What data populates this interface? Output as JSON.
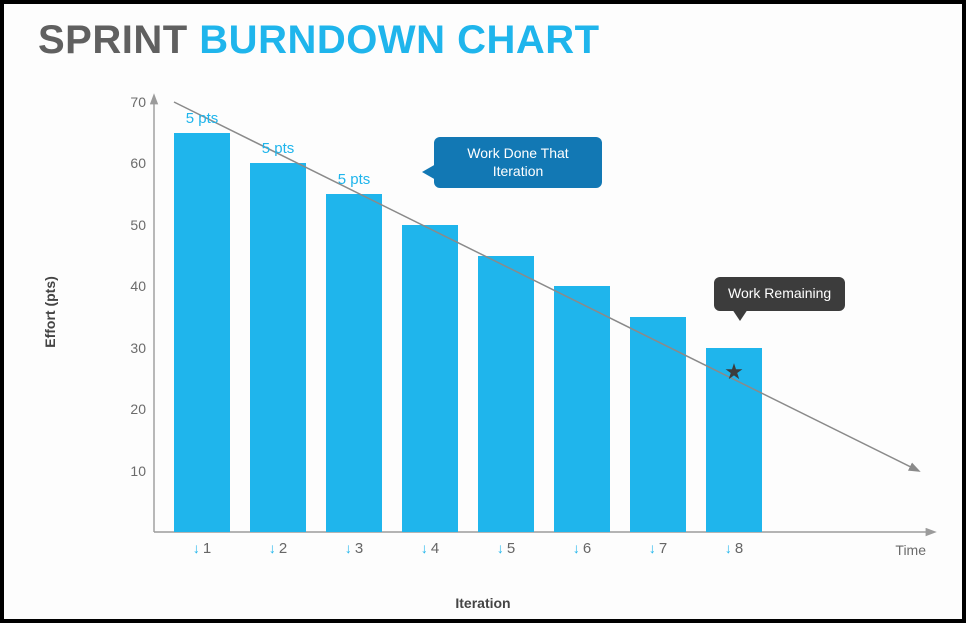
{
  "title": {
    "a": "SPRINT ",
    "b": "BURNDOWN CHART"
  },
  "ylabel": "Effort (pts)",
  "xlabel": "Iteration",
  "x_time": "Time",
  "callouts": {
    "work_done": "Work Done That Iteration",
    "work_remaining": "Work Remaining"
  },
  "chart_data": {
    "type": "bar",
    "categories": [
      "1",
      "2",
      "3",
      "4",
      "5",
      "6",
      "7",
      "8"
    ],
    "values": [
      65,
      60,
      55,
      50,
      45,
      40,
      35,
      30
    ],
    "bar_labels": [
      "5 pts",
      "5 pts",
      "5 pts",
      "",
      "",
      "",
      "",
      ""
    ],
    "ylim": [
      0,
      70
    ],
    "yticks": [
      10,
      20,
      30,
      40,
      50,
      60,
      70
    ],
    "trend": {
      "x1": 0,
      "y1": 70,
      "x2": 1,
      "y2": 10
    },
    "star_index": 7,
    "star_value": 26,
    "title": "Sprint Burndown Chart",
    "xlabel": "Iteration",
    "ylabel": "Effort (pts)"
  }
}
